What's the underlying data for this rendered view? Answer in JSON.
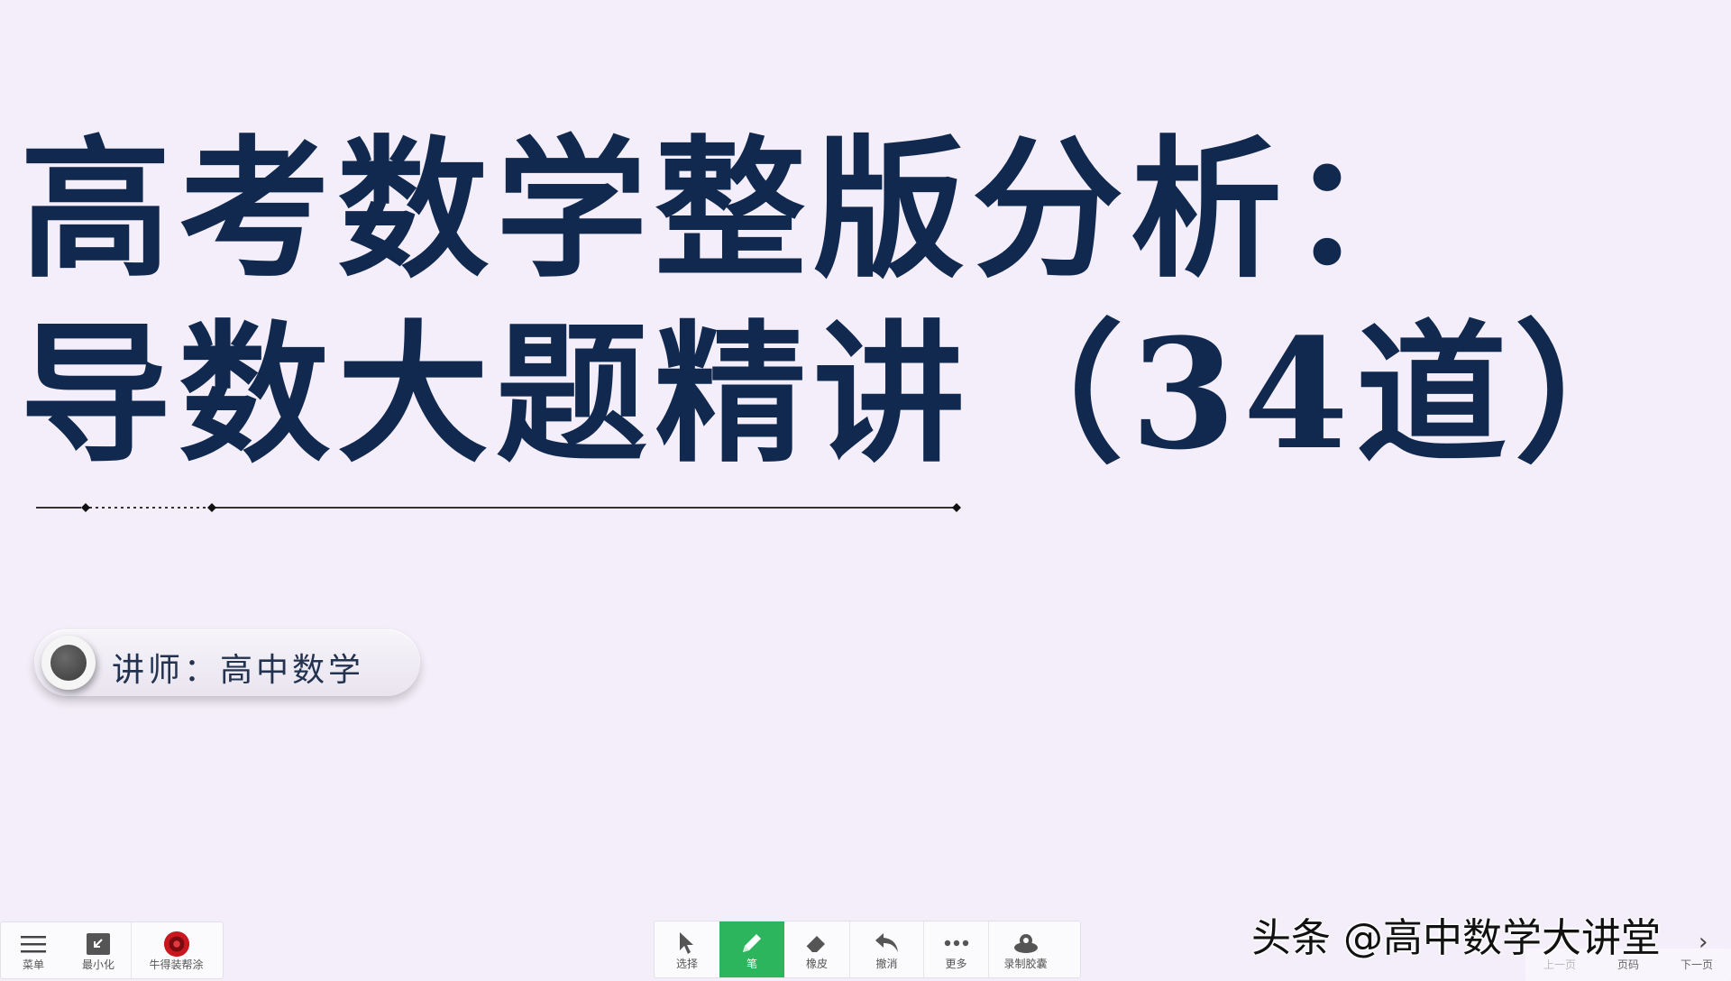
{
  "slide": {
    "title_line_1": "高考数学整版分析：",
    "title_line_2": "导数大题精讲（34道）",
    "lecturer": "讲师：高中数学"
  },
  "toolbar_left": {
    "menu_label": "菜单",
    "minimize_label": "最小化",
    "app_label": "牛得装帮涂"
  },
  "toolbar_center": {
    "select_label": "选择",
    "pen_label": "笔",
    "eraser_label": "橡皮",
    "undo_label": "撤消",
    "more_label": "更多",
    "record_label": "录制胶囊"
  },
  "toolbar_right": {
    "prev_label": "上一页",
    "page_label": "页码",
    "next_label": "下一页"
  },
  "watermark": "头条 @高中数学大讲堂",
  "colors": {
    "background": "#f3eef9",
    "title": "#12294f",
    "active_tool": "#2db55d"
  },
  "icons": [
    "menu-icon",
    "minimize-icon",
    "app-icon",
    "cursor-icon",
    "pen-icon",
    "eraser-icon",
    "undo-icon",
    "more-icon",
    "record-icon",
    "chevron-right-icon"
  ]
}
